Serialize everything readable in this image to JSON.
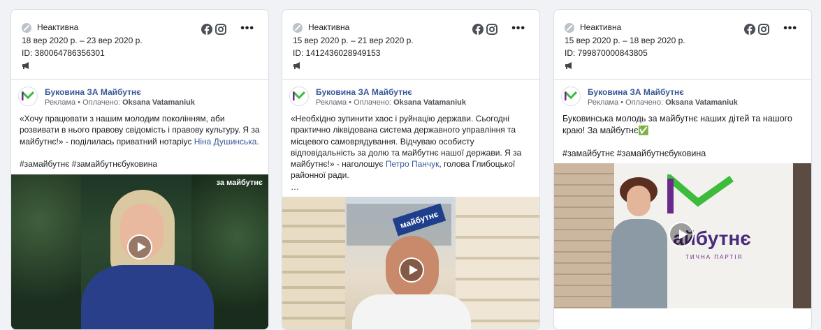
{
  "ads": [
    {
      "status": "Неактивна",
      "dates": "18 вер 2020 р. – 23 вер 2020 р.",
      "id": "ID: 380064786356301",
      "page_name": "Буковина ЗА Майбутнє",
      "sponsor_prefix": "Реклама • Оплачено: ",
      "sponsor_name": "Oksana Vatamaniuk",
      "text_1": "«Хочу працювати з нашим молодим поколінням, аби розвивати в нього правову свідомість і правову культуру. Я за майбутнє!» - поділилась приватний нотаріус ",
      "text_link": "Ніна Душинська",
      "text_2": ".",
      "hashtags": "#замайбутнє #замайбутнєбуковина",
      "video_badge": "за майбутнє"
    },
    {
      "status": "Неактивна",
      "dates": "15 вер 2020 р. – 21 вер 2020 р.",
      "id": "ID: 1412436028949153",
      "page_name": "Буковина ЗА Майбутнє",
      "sponsor_prefix": "Реклама • Оплачено: ",
      "sponsor_name": "Oksana Vatamaniuk",
      "text_1": "«Необхідно зупинити хаос і руйнацію держави. Сьогодні практично ліквідована система державного управління та місцевого самоврядування. Відчуваю особисту відповідальність за долю та майбутнє нашої держави. Я за майбутнє!» - наголошує ",
      "text_link": "Петро Панчук",
      "text_2": ", голова Глибоцької районної ради.",
      "ellipsis": "…",
      "video_sign": "майбутнє"
    },
    {
      "status": "Неактивна",
      "dates": "15 вер 2020 р. – 18 вер 2020 р.",
      "id": "ID: 799870000843805",
      "page_name": "Буковина ЗА Майбутнє",
      "sponsor_prefix": "Реклама • Оплачено: ",
      "sponsor_name": "Oksana Vatamaniuk",
      "text_1": "Буковинська молодь за майбутнє наших дітей та нашого краю! За майбутнє✅",
      "hashtags": "#замайбутнє #замайбутнєбуковина",
      "video_sign": "айбутнє",
      "video_sign_sub": "ТИЧНА ПАРТІЯ"
    }
  ],
  "icons": [
    "inactive-status-icon",
    "facebook-icon",
    "instagram-icon",
    "more-options-icon",
    "megaphone-icon",
    "play-icon"
  ],
  "colors": {
    "link": "#385898",
    "brand_green": "#3dbb3d",
    "brand_purple": "#6a2a8c"
  }
}
